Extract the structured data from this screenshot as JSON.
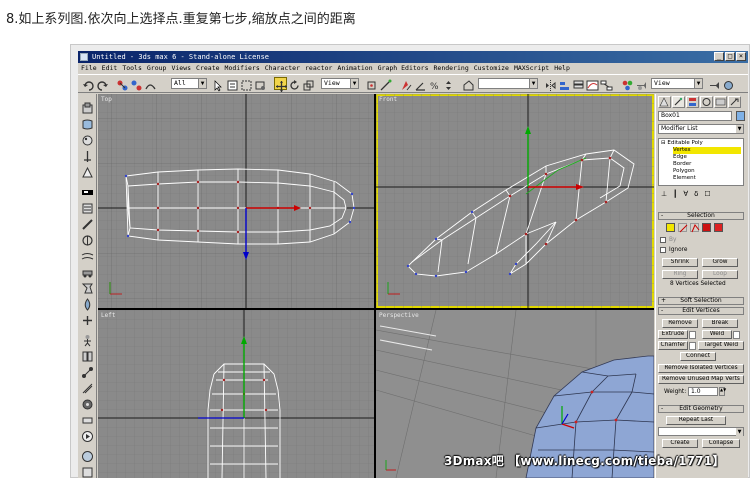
{
  "caption": "8.如上系列图.依次向上选择点.重复第七步,缩放点之间的距离",
  "window": {
    "title": "Untitled - 3ds max 6 - Stand-alone License",
    "controls": [
      "_",
      "□",
      "×"
    ]
  },
  "menu": [
    "File",
    "Edit",
    "Tools",
    "Group",
    "Views",
    "Create",
    "Modifiers",
    "Character",
    "reactor",
    "Animation",
    "Graph Editors",
    "Rendering",
    "Customize",
    "MAXScript",
    "Help"
  ],
  "toolbar": {
    "filter_value": "All",
    "coord_value": "View",
    "named_sel_value": "",
    "right_view_value": "View"
  },
  "viewports": {
    "top_label": "Top",
    "front_label": "Front",
    "left_label": "Left",
    "perspective_label": "Perspective"
  },
  "command_panel": {
    "object_name": "Box01",
    "modifier_list": "Modifier List",
    "stack": {
      "root": "Editable Poly",
      "items": [
        "Vertex",
        "Edge",
        "Border",
        "Polygon",
        "Element"
      ],
      "selected": "Vertex"
    },
    "selection": {
      "title": "Selection",
      "by_label": "By",
      "ignore_label": "Ignore",
      "shrink": "Shrink",
      "grow": "Grow",
      "ring": "Ring",
      "loop": "Loop",
      "status": "8 Vertices Selected"
    },
    "soft_selection": "Soft Selection",
    "edit_vertices": {
      "title": "Edit Vertices",
      "remove": "Remove",
      "break": "Break",
      "extrude": "Extrude",
      "weld": "Weld",
      "chamfer": "Chamfer",
      "target_weld": "Target Weld",
      "connect": "Connect",
      "remove_isolated": "Remove Isolated Vertices",
      "remove_unused": "Remove Unused Map Verts",
      "weight_label": "Weight:",
      "weight_value": "1.0"
    },
    "edit_geometry": {
      "title": "Edit Geometry",
      "repeat_last": "Repeat Last",
      "create": "Create",
      "collapse": "Collapse"
    }
  },
  "watermark": "3Dmax吧 【www.linecg.com/tieba/1771】",
  "colors": {
    "viewport_bg": "#8a8a8a",
    "wire": "#ffffff",
    "vertex": "#b00000",
    "active_border": "#e0d800",
    "stack_highlight": "#f2e600",
    "title_bar": "#0a246a"
  }
}
